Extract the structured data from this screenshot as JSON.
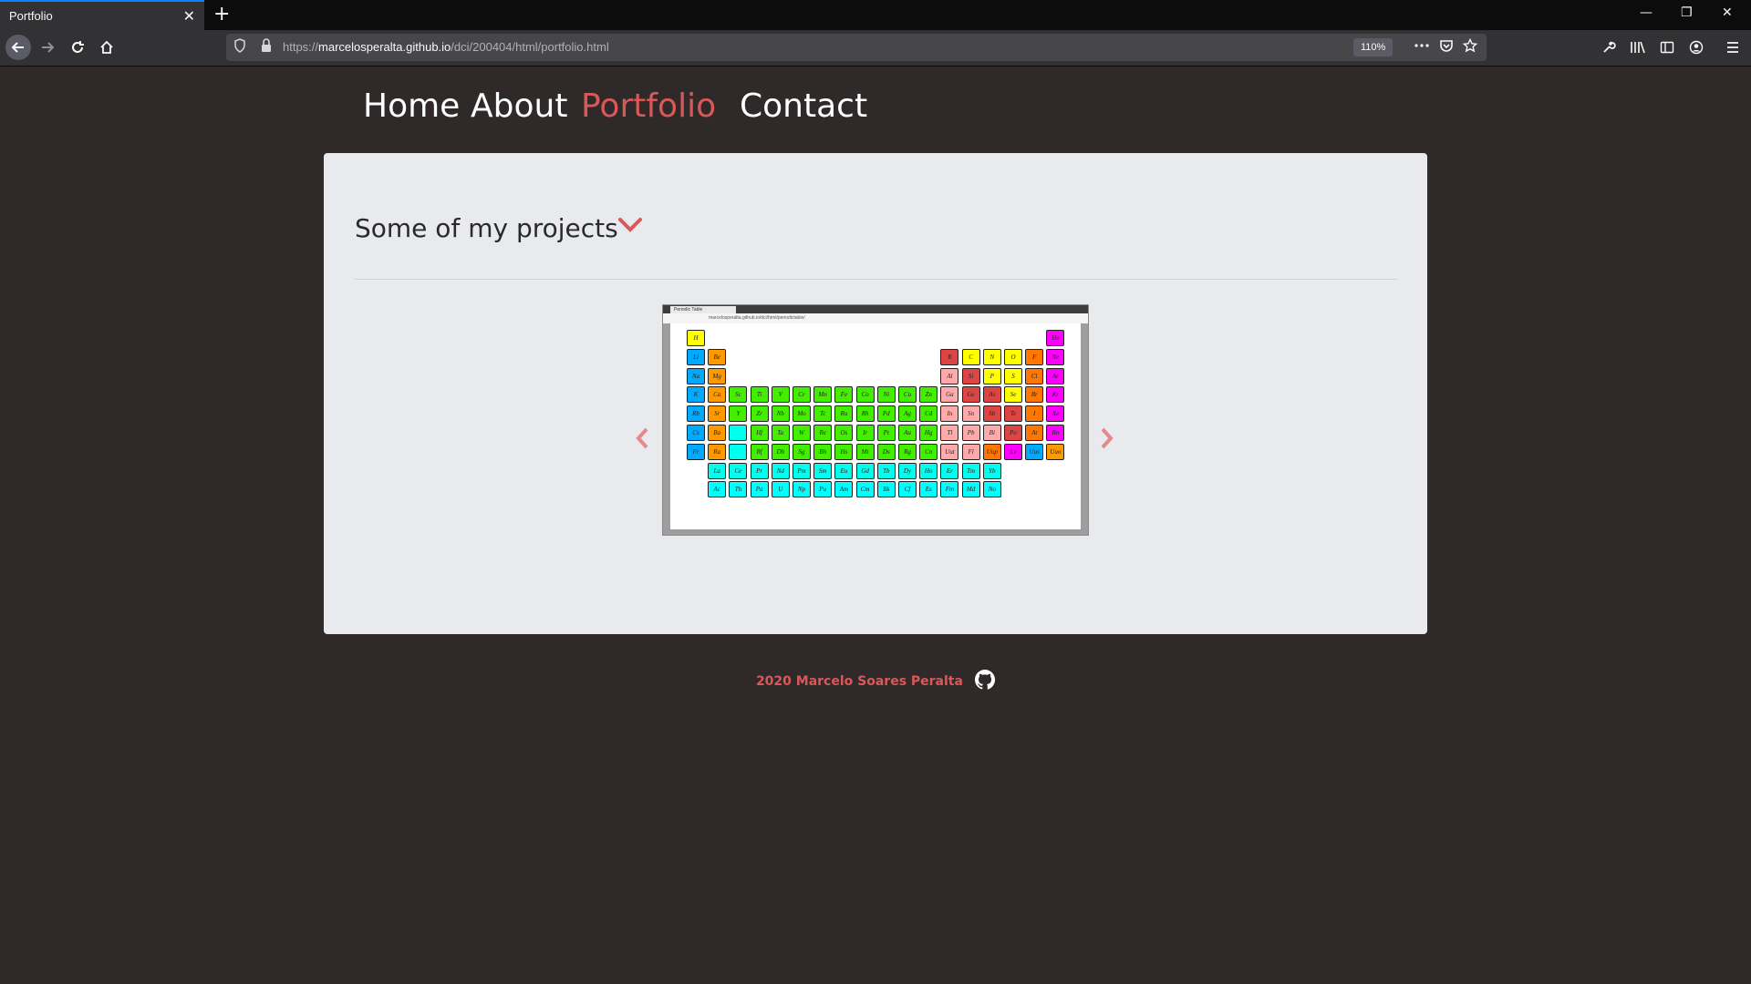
{
  "browser": {
    "tab_title": "Portfolio",
    "tab_close": "✕",
    "new_tab": "+",
    "url_prefix": "https://",
    "url_host": "marcelosperalta.github.io",
    "url_path": "/dci/200404/html/portfolio.html",
    "zoom": "110%",
    "window_controls": [
      "—",
      "❐",
      "✕"
    ]
  },
  "nav": {
    "items": [
      {
        "label": "Home",
        "active": false
      },
      {
        "label": "About",
        "active": false
      },
      {
        "label": "Portfolio",
        "active": true
      },
      {
        "label": "Contact",
        "active": false
      }
    ]
  },
  "main": {
    "heading": "Some of my projects",
    "carousel": {
      "prev_label": "‹",
      "next_label": "›",
      "slide": {
        "tab_title": "Periodic Table",
        "url": "marcelosperalta.github.io/dci/html/periodictable/",
        "rows": [
          {
            "offset": 0,
            "cells": [
              [
                "H",
                "#ffff00"
              ]
            ]
          },
          {
            "offset": 0,
            "cells": [
              [
                "Li",
                "#00aaff"
              ],
              [
                "Be",
                "#ff9900"
              ]
            ]
          },
          {
            "offset": 0,
            "cells": [
              [
                "Na",
                "#00aaff"
              ],
              [
                "Mg",
                "#ff9900"
              ]
            ]
          },
          {
            "offset": 0,
            "cells": [
              [
                "K",
                "#00aaff"
              ],
              [
                "Ca",
                "#ff9900"
              ],
              [
                "Sc",
                "#44ee00"
              ],
              [
                "Ti",
                "#44ee00"
              ],
              [
                "V",
                "#44ee00"
              ],
              [
                "Cr",
                "#44ee00"
              ],
              [
                "Mn",
                "#44ee00"
              ],
              [
                "Fe",
                "#44ee00"
              ],
              [
                "Co",
                "#44ee00"
              ],
              [
                "Ni",
                "#44ee00"
              ],
              [
                "Cu",
                "#44ee00"
              ],
              [
                "Zn",
                "#44ee00"
              ],
              [
                "Ga",
                "#ffaaaa"
              ],
              [
                "Ge",
                "#dd4444"
              ],
              [
                "As",
                "#dd4444"
              ],
              [
                "Se",
                "#ffff00"
              ],
              [
                "Br",
                "#ff7700"
              ],
              [
                "Kr",
                "#ff00ff"
              ]
            ]
          },
          {
            "offset": 0,
            "cells": [
              [
                "Rb",
                "#00aaff"
              ],
              [
                "Sr",
                "#ff9900"
              ],
              [
                "Y",
                "#44ee00"
              ],
              [
                "Zr",
                "#44ee00"
              ],
              [
                "Nb",
                "#44ee00"
              ],
              [
                "Mo",
                "#44ee00"
              ],
              [
                "Tc",
                "#44ee00"
              ],
              [
                "Ru",
                "#44ee00"
              ],
              [
                "Rh",
                "#44ee00"
              ],
              [
                "Pd",
                "#44ee00"
              ],
              [
                "Ag",
                "#44ee00"
              ],
              [
                "Cd",
                "#44ee00"
              ],
              [
                "In",
                "#ffaaaa"
              ],
              [
                "Sn",
                "#ffaaaa"
              ],
              [
                "Sb",
                "#dd4444"
              ],
              [
                "Te",
                "#dd4444"
              ],
              [
                "I",
                "#ff7700"
              ],
              [
                "Xe",
                "#ff00ff"
              ]
            ]
          },
          {
            "offset": 0,
            "cells": [
              [
                "Cs",
                "#00aaff"
              ],
              [
                "Ba",
                "#ff9900"
              ],
              [
                "",
                "#00ffee"
              ],
              [
                "Hf",
                "#44ee00"
              ],
              [
                "Ta",
                "#44ee00"
              ],
              [
                "W",
                "#44ee00"
              ],
              [
                "Re",
                "#44ee00"
              ],
              [
                "Os",
                "#44ee00"
              ],
              [
                "Ir",
                "#44ee00"
              ],
              [
                "Pt",
                "#44ee00"
              ],
              [
                "Au",
                "#44ee00"
              ],
              [
                "Hg",
                "#44ee00"
              ],
              [
                "Tl",
                "#ffaaaa"
              ],
              [
                "Pb",
                "#ffaaaa"
              ],
              [
                "Bi",
                "#ffaaaa"
              ],
              [
                "Po",
                "#dd4444"
              ],
              [
                "At",
                "#ff7700"
              ],
              [
                "Rn",
                "#ff00ff"
              ]
            ]
          },
          {
            "offset": 0,
            "cells": [
              [
                "Fr",
                "#00aaff"
              ],
              [
                "Ra",
                "#ff9900"
              ],
              [
                "",
                "#00ffee"
              ],
              [
                "Rf",
                "#44ee00"
              ],
              [
                "Db",
                "#44ee00"
              ],
              [
                "Sg",
                "#44ee00"
              ],
              [
                "Bh",
                "#44ee00"
              ],
              [
                "Hs",
                "#44ee00"
              ],
              [
                "Mt",
                "#44ee00"
              ],
              [
                "Ds",
                "#44ee00"
              ],
              [
                "Rg",
                "#44ee00"
              ],
              [
                "Cn",
                "#44ee00"
              ],
              [
                "Uut",
                "#ffaaaa"
              ],
              [
                "Fl",
                "#ffaaaa"
              ],
              [
                "Uup",
                "#ff7700"
              ],
              [
                "Lv",
                "#ff00ff"
              ],
              [
                "Uus",
                "#00aaff"
              ],
              [
                "Uuo",
                "#ff9900"
              ]
            ]
          },
          {
            "offset": 1,
            "cells": [
              [
                "La",
                "#00ffee"
              ],
              [
                "Ce",
                "#00ffee"
              ],
              [
                "Pr",
                "#00ffee"
              ],
              [
                "Nd",
                "#00ffee"
              ],
              [
                "Pm",
                "#00ffee"
              ],
              [
                "Sm",
                "#00ffee"
              ],
              [
                "Eu",
                "#00ffee"
              ],
              [
                "Gd",
                "#00ffee"
              ],
              [
                "Tb",
                "#00ffee"
              ],
              [
                "Dy",
                "#00ffee"
              ],
              [
                "Ho",
                "#00ffee"
              ],
              [
                "Er",
                "#00ffee"
              ],
              [
                "Tm",
                "#00ffee"
              ],
              [
                "Yb",
                "#00ffee"
              ]
            ]
          },
          {
            "offset": 1,
            "cells": [
              [
                "Ac",
                "#00ffff"
              ],
              [
                "Th",
                "#00ffff"
              ],
              [
                "Pa",
                "#00ffff"
              ],
              [
                "U",
                "#00ffff"
              ],
              [
                "Np",
                "#00ffff"
              ],
              [
                "Pu",
                "#00ffff"
              ],
              [
                "Am",
                "#00ffff"
              ],
              [
                "Cm",
                "#00ffff"
              ],
              [
                "Bk",
                "#00ffff"
              ],
              [
                "Cf",
                "#00ffff"
              ],
              [
                "Es",
                "#00ffff"
              ],
              [
                "Fm",
                "#00ffff"
              ],
              [
                "Md",
                "#00ffff"
              ],
              [
                "No",
                "#00ffff"
              ]
            ]
          }
        ],
        "right_block": {
          "top": [
            [
              "He",
              "#ff00ff"
            ]
          ],
          "p2": [
            [
              "B",
              "#dd4444"
            ],
            [
              "C",
              "#ffff00"
            ],
            [
              "N",
              "#ffff00"
            ],
            [
              "O",
              "#ffff00"
            ],
            [
              "F",
              "#ff7700"
            ],
            [
              "Ne",
              "#ff00ff"
            ]
          ],
          "p3": [
            [
              "Al",
              "#ffaaaa"
            ],
            [
              "Si",
              "#dd4444"
            ],
            [
              "P",
              "#ffff00"
            ],
            [
              "S",
              "#ffff00"
            ],
            [
              "Cl",
              "#ff7700"
            ],
            [
              "Ar",
              "#ff00ff"
            ]
          ]
        }
      }
    }
  },
  "footer": {
    "text": "2020 Marcelo Soares Peralta",
    "icon": "github-icon"
  },
  "colors": {
    "accent": "#d9585a",
    "page_bg": "#2f2a29",
    "card_bg": "#e8eaed"
  }
}
